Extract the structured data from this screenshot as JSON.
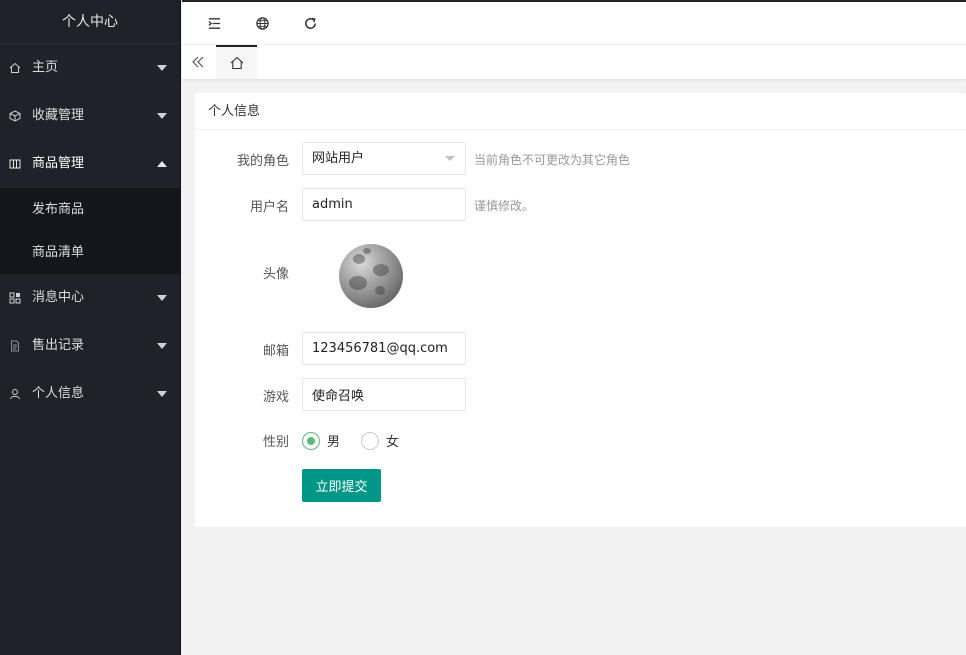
{
  "sidebar": {
    "title": "个人中心",
    "items": [
      {
        "label": "主页",
        "icon": "home-icon"
      },
      {
        "label": "收藏管理",
        "icon": "cube-icon"
      },
      {
        "label": "商品管理",
        "icon": "columns-icon",
        "open": true,
        "children": [
          {
            "label": "发布商品"
          },
          {
            "label": "商品清单"
          }
        ]
      },
      {
        "label": "消息中心",
        "icon": "apps-icon"
      },
      {
        "label": "售出记录",
        "icon": "file-icon"
      },
      {
        "label": "个人信息",
        "icon": "user-icon"
      }
    ]
  },
  "topbar": {
    "icons": [
      "menu-shrink-icon",
      "globe-icon",
      "refresh-icon"
    ]
  },
  "tabs": {
    "prev_icon": "double-left-icon",
    "home_icon": "home-icon"
  },
  "card": {
    "title": "个人信息",
    "role": {
      "label": "我的角色",
      "value": "网站用户",
      "hint": "当前角色不可更改为其它角色"
    },
    "username": {
      "label": "用户名",
      "value": "admin",
      "hint": "谨慎修改。"
    },
    "avatar": {
      "label": "头像"
    },
    "email": {
      "label": "邮箱",
      "value": "123456781@qq.com"
    },
    "game": {
      "label": "游戏",
      "value": "使命召唤"
    },
    "gender": {
      "label": "性别",
      "options": [
        "男",
        "女"
      ],
      "selected": "男"
    },
    "submit_label": "立即提交"
  },
  "colors": {
    "sidebar_bg": "#20222a",
    "submenu_bg": "#15161b",
    "primary": "#009688",
    "radio_checked": "#5fb878"
  }
}
